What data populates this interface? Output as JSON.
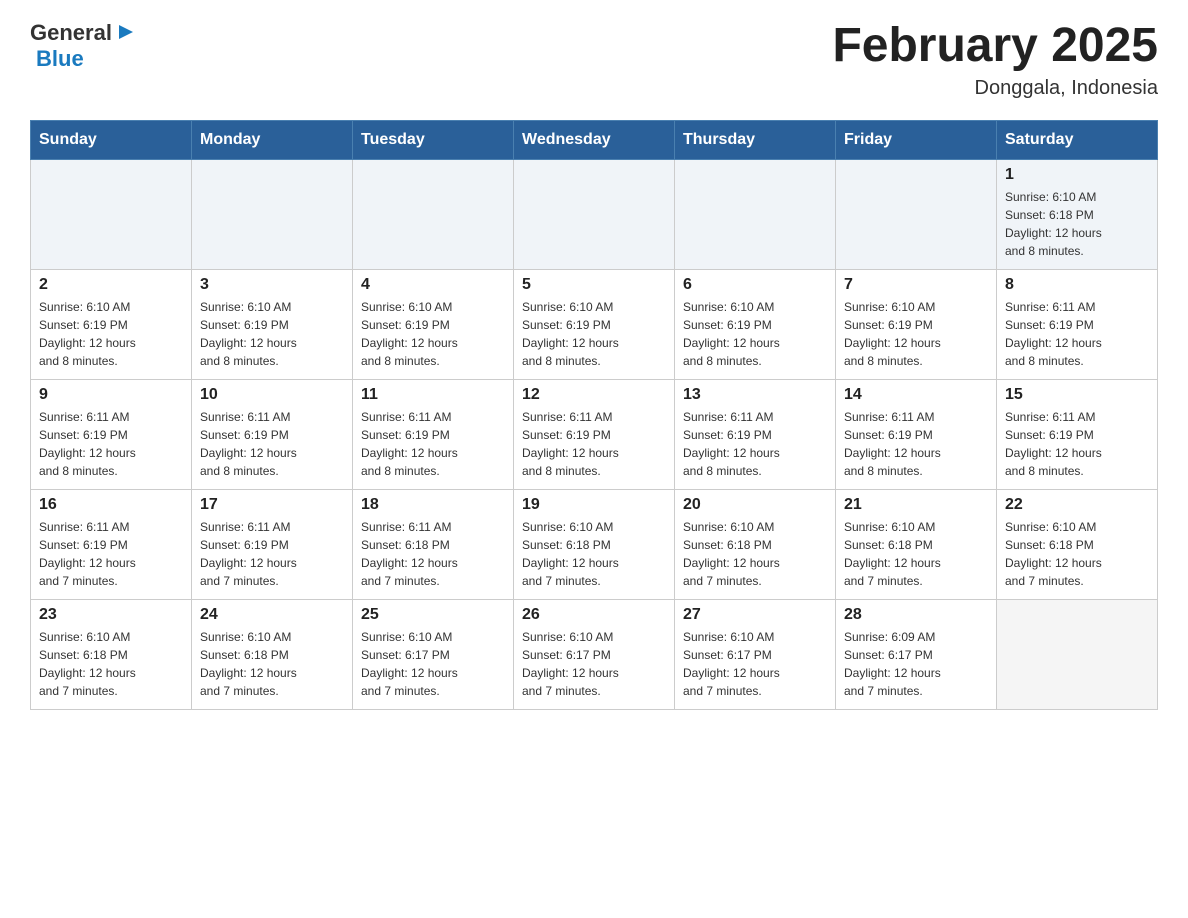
{
  "header": {
    "logo": {
      "text_general": "General",
      "text_blue": "Blue",
      "arrow": "▶"
    },
    "title": "February 2025",
    "subtitle": "Donggala, Indonesia"
  },
  "calendar": {
    "days_of_week": [
      "Sunday",
      "Monday",
      "Tuesday",
      "Wednesday",
      "Thursday",
      "Friday",
      "Saturday"
    ],
    "weeks": [
      {
        "days": [
          {
            "number": "",
            "info": ""
          },
          {
            "number": "",
            "info": ""
          },
          {
            "number": "",
            "info": ""
          },
          {
            "number": "",
            "info": ""
          },
          {
            "number": "",
            "info": ""
          },
          {
            "number": "",
            "info": ""
          },
          {
            "number": "1",
            "info": "Sunrise: 6:10 AM\nSunset: 6:18 PM\nDaylight: 12 hours\nand 8 minutes."
          }
        ]
      },
      {
        "days": [
          {
            "number": "2",
            "info": "Sunrise: 6:10 AM\nSunset: 6:19 PM\nDaylight: 12 hours\nand 8 minutes."
          },
          {
            "number": "3",
            "info": "Sunrise: 6:10 AM\nSunset: 6:19 PM\nDaylight: 12 hours\nand 8 minutes."
          },
          {
            "number": "4",
            "info": "Sunrise: 6:10 AM\nSunset: 6:19 PM\nDaylight: 12 hours\nand 8 minutes."
          },
          {
            "number": "5",
            "info": "Sunrise: 6:10 AM\nSunset: 6:19 PM\nDaylight: 12 hours\nand 8 minutes."
          },
          {
            "number": "6",
            "info": "Sunrise: 6:10 AM\nSunset: 6:19 PM\nDaylight: 12 hours\nand 8 minutes."
          },
          {
            "number": "7",
            "info": "Sunrise: 6:10 AM\nSunset: 6:19 PM\nDaylight: 12 hours\nand 8 minutes."
          },
          {
            "number": "8",
            "info": "Sunrise: 6:11 AM\nSunset: 6:19 PM\nDaylight: 12 hours\nand 8 minutes."
          }
        ]
      },
      {
        "days": [
          {
            "number": "9",
            "info": "Sunrise: 6:11 AM\nSunset: 6:19 PM\nDaylight: 12 hours\nand 8 minutes."
          },
          {
            "number": "10",
            "info": "Sunrise: 6:11 AM\nSunset: 6:19 PM\nDaylight: 12 hours\nand 8 minutes."
          },
          {
            "number": "11",
            "info": "Sunrise: 6:11 AM\nSunset: 6:19 PM\nDaylight: 12 hours\nand 8 minutes."
          },
          {
            "number": "12",
            "info": "Sunrise: 6:11 AM\nSunset: 6:19 PM\nDaylight: 12 hours\nand 8 minutes."
          },
          {
            "number": "13",
            "info": "Sunrise: 6:11 AM\nSunset: 6:19 PM\nDaylight: 12 hours\nand 8 minutes."
          },
          {
            "number": "14",
            "info": "Sunrise: 6:11 AM\nSunset: 6:19 PM\nDaylight: 12 hours\nand 8 minutes."
          },
          {
            "number": "15",
            "info": "Sunrise: 6:11 AM\nSunset: 6:19 PM\nDaylight: 12 hours\nand 8 minutes."
          }
        ]
      },
      {
        "days": [
          {
            "number": "16",
            "info": "Sunrise: 6:11 AM\nSunset: 6:19 PM\nDaylight: 12 hours\nand 7 minutes."
          },
          {
            "number": "17",
            "info": "Sunrise: 6:11 AM\nSunset: 6:19 PM\nDaylight: 12 hours\nand 7 minutes."
          },
          {
            "number": "18",
            "info": "Sunrise: 6:11 AM\nSunset: 6:18 PM\nDaylight: 12 hours\nand 7 minutes."
          },
          {
            "number": "19",
            "info": "Sunrise: 6:10 AM\nSunset: 6:18 PM\nDaylight: 12 hours\nand 7 minutes."
          },
          {
            "number": "20",
            "info": "Sunrise: 6:10 AM\nSunset: 6:18 PM\nDaylight: 12 hours\nand 7 minutes."
          },
          {
            "number": "21",
            "info": "Sunrise: 6:10 AM\nSunset: 6:18 PM\nDaylight: 12 hours\nand 7 minutes."
          },
          {
            "number": "22",
            "info": "Sunrise: 6:10 AM\nSunset: 6:18 PM\nDaylight: 12 hours\nand 7 minutes."
          }
        ]
      },
      {
        "days": [
          {
            "number": "23",
            "info": "Sunrise: 6:10 AM\nSunset: 6:18 PM\nDaylight: 12 hours\nand 7 minutes."
          },
          {
            "number": "24",
            "info": "Sunrise: 6:10 AM\nSunset: 6:18 PM\nDaylight: 12 hours\nand 7 minutes."
          },
          {
            "number": "25",
            "info": "Sunrise: 6:10 AM\nSunset: 6:17 PM\nDaylight: 12 hours\nand 7 minutes."
          },
          {
            "number": "26",
            "info": "Sunrise: 6:10 AM\nSunset: 6:17 PM\nDaylight: 12 hours\nand 7 minutes."
          },
          {
            "number": "27",
            "info": "Sunrise: 6:10 AM\nSunset: 6:17 PM\nDaylight: 12 hours\nand 7 minutes."
          },
          {
            "number": "28",
            "info": "Sunrise: 6:09 AM\nSunset: 6:17 PM\nDaylight: 12 hours\nand 7 minutes."
          },
          {
            "number": "",
            "info": ""
          }
        ]
      }
    ]
  },
  "colors": {
    "header_bg": "#2a6099",
    "header_text": "#ffffff",
    "accent": "#1a7abf"
  }
}
